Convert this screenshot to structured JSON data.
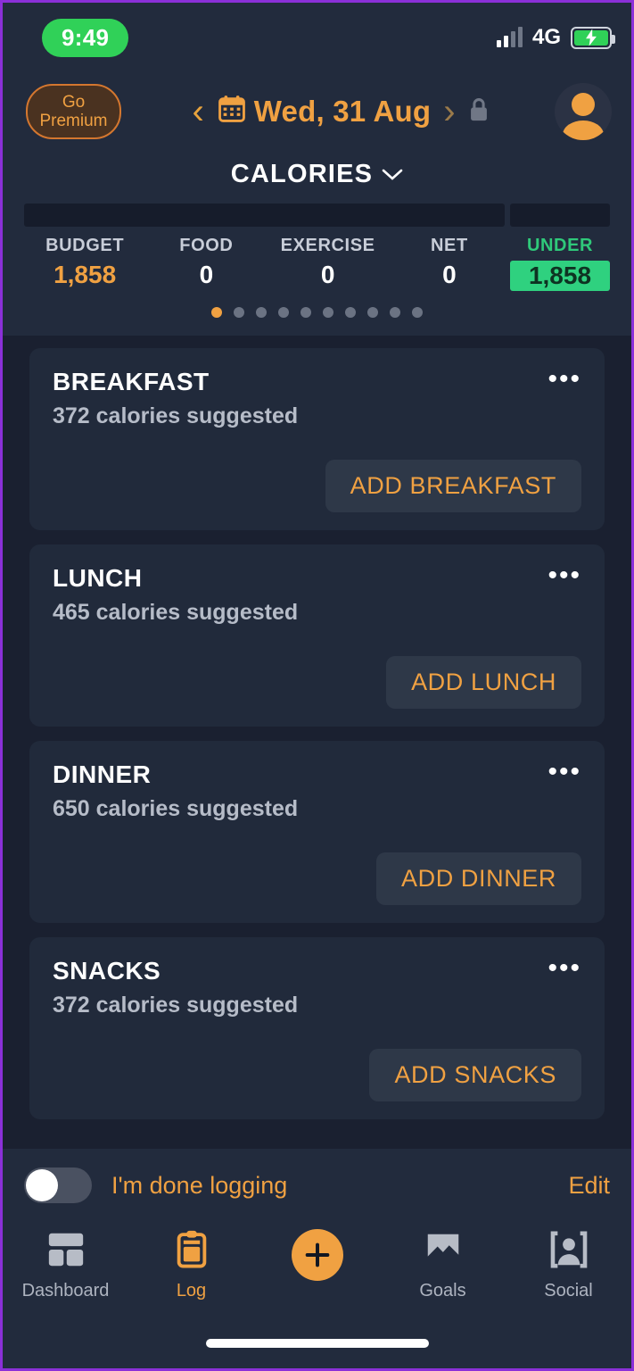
{
  "status_bar": {
    "time": "9:49",
    "network": "4G",
    "signal_icon": "signal-bars-icon",
    "battery_icon": "battery-charging-icon"
  },
  "header": {
    "premium_line1": "Go",
    "premium_line2": "Premium",
    "prev_label": "‹",
    "next_label": "›",
    "date": "Wed, 31 Aug",
    "calendar_icon": "calendar-icon",
    "lock_icon": "lock-icon",
    "avatar_icon": "user-avatar-icon"
  },
  "summary": {
    "title": "CALORIES",
    "chevron": "⌄",
    "stats": [
      {
        "label": "BUDGET",
        "value": "1,858"
      },
      {
        "label": "FOOD",
        "value": "0"
      },
      {
        "label": "EXERCISE",
        "value": "0"
      },
      {
        "label": "NET",
        "value": "0"
      },
      {
        "label": "UNDER",
        "value": "1,858"
      }
    ],
    "pager_total": 10,
    "pager_active": 1,
    "accent_color": "#f0a142",
    "under_color": "#2fd17f"
  },
  "meals": [
    {
      "title": "BREAKFAST",
      "suggestion": "372 calories suggested",
      "add_label": "ADD BREAKFAST",
      "menu": "•••"
    },
    {
      "title": "LUNCH",
      "suggestion": "465 calories suggested",
      "add_label": "ADD LUNCH",
      "menu": "•••"
    },
    {
      "title": "DINNER",
      "suggestion": "650 calories suggested",
      "add_label": "ADD DINNER",
      "menu": "•••"
    },
    {
      "title": "SNACKS",
      "suggestion": "372 calories suggested",
      "add_label": "ADD SNACKS",
      "menu": "•••"
    }
  ],
  "done_bar": {
    "toggle_label": "I'm done logging",
    "toggle_on": false,
    "edit_label": "Edit"
  },
  "tabbar": {
    "items": [
      {
        "label": "Dashboard",
        "icon": "dashboard-grid-icon",
        "active": false
      },
      {
        "label": "Log",
        "icon": "clipboard-icon",
        "active": true
      },
      {
        "label": "",
        "icon": "plus-icon",
        "active": false
      },
      {
        "label": "Goals",
        "icon": "chart-icon",
        "active": false
      },
      {
        "label": "Social",
        "icon": "people-icon",
        "active": false
      }
    ]
  }
}
